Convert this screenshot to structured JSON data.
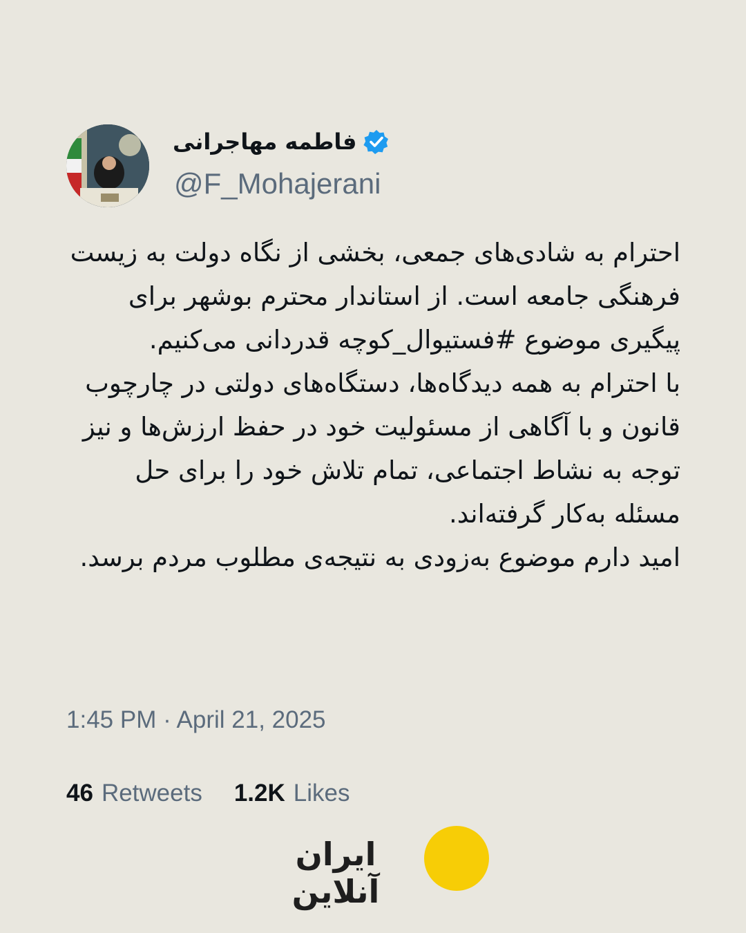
{
  "author": {
    "display_name": "فاطمه مهاجرانی",
    "handle": "@F_Mohajerani",
    "verified": true,
    "verified_color": "#1d9bf0",
    "avatar_icon": "profile-photo"
  },
  "tweet": {
    "paragraphs": [
      "احترام به شادی‌های جمعی، بخشی از نگاه دولت به زیست فرهنگی جامعه است. از استاندار محترم بوشهر برای پیگیری موضوع #فستیوال_کوچه قدردانی می‌کنیم.",
      "با احترام به همه دیدگاه‌ها، دستگاه‌های دولتی در چارچوب قانون و با آگاهی از مسئولیت خود در حفظ ارزش‌ها و نیز توجه به نشاط اجتماعی، تمام تلاش خود را برای حل مسئله به‌کار گرفته‌اند.",
      "امید دارم موضوع به‌زودی به نتیجه‌ی مطلوب مردم برسد."
    ],
    "timestamp": "1:45 PM · April 21, 2025"
  },
  "stats": {
    "retweets_count": "46",
    "retweets_label": "Retweets",
    "likes_count": "1.2K",
    "likes_label": "Likes"
  },
  "brand": {
    "name": "ایران آنلاین",
    "dot_color": "#f7cd06"
  },
  "colors": {
    "background": "#e9e7df",
    "text": "#0f1419",
    "muted": "#5b6b7c"
  }
}
